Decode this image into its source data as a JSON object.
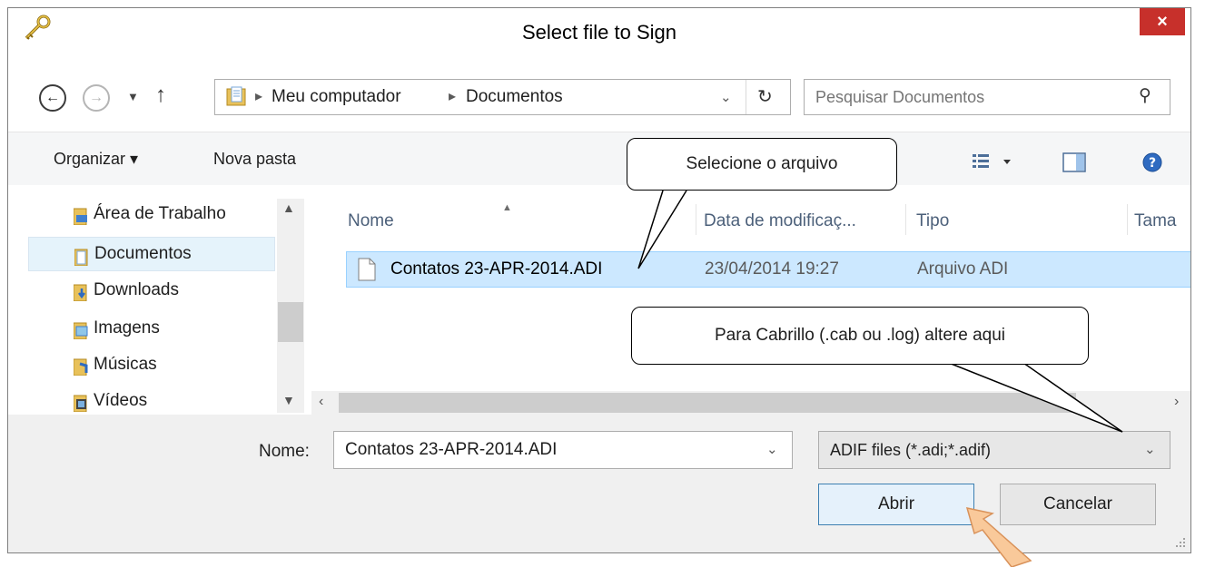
{
  "window": {
    "title": "Select file to Sign",
    "close_glyph": "×"
  },
  "address": {
    "path": [
      "Meu computador",
      "Documentos"
    ],
    "chevron": "▸"
  },
  "search": {
    "placeholder": "Pesquisar Documentos"
  },
  "toolbar": {
    "organize_label": "Organizar ▾",
    "new_folder_label": "Nova pasta"
  },
  "sidebar": {
    "items": [
      {
        "label": "Área de Trabalho",
        "icon": "desktop-folder-icon"
      },
      {
        "label": "Documentos",
        "icon": "documents-folder-icon"
      },
      {
        "label": "Downloads",
        "icon": "downloads-folder-icon"
      },
      {
        "label": "Imagens",
        "icon": "pictures-folder-icon"
      },
      {
        "label": "Músicas",
        "icon": "music-folder-icon"
      },
      {
        "label": "Vídeos",
        "icon": "videos-folder-icon"
      }
    ],
    "selected": "Documentos"
  },
  "file_list": {
    "columns": [
      "Nome",
      "Data de modificaç...",
      "Tipo",
      "Tama"
    ],
    "rows": [
      {
        "name": "Contatos 23-APR-2014.ADI",
        "modified": "23/04/2014 19:27",
        "type": "Arquivo ADI"
      }
    ]
  },
  "footer": {
    "filename_label": "Nome:",
    "filename_value": "Contatos 23-APR-2014.ADI",
    "filter_value": "ADIF files (*.adi;*.adif)",
    "open_label": "Abrir",
    "cancel_label": "Cancelar"
  },
  "callouts": {
    "select_file": "Selecione o arquivo",
    "cabrillo": "Para Cabrillo (.cab ou .log) altere aqui"
  },
  "colors": {
    "selection": "#cce8ff",
    "selection_border": "#99d1ff",
    "close": "#c7302b",
    "arrow": "#f9c99a"
  }
}
